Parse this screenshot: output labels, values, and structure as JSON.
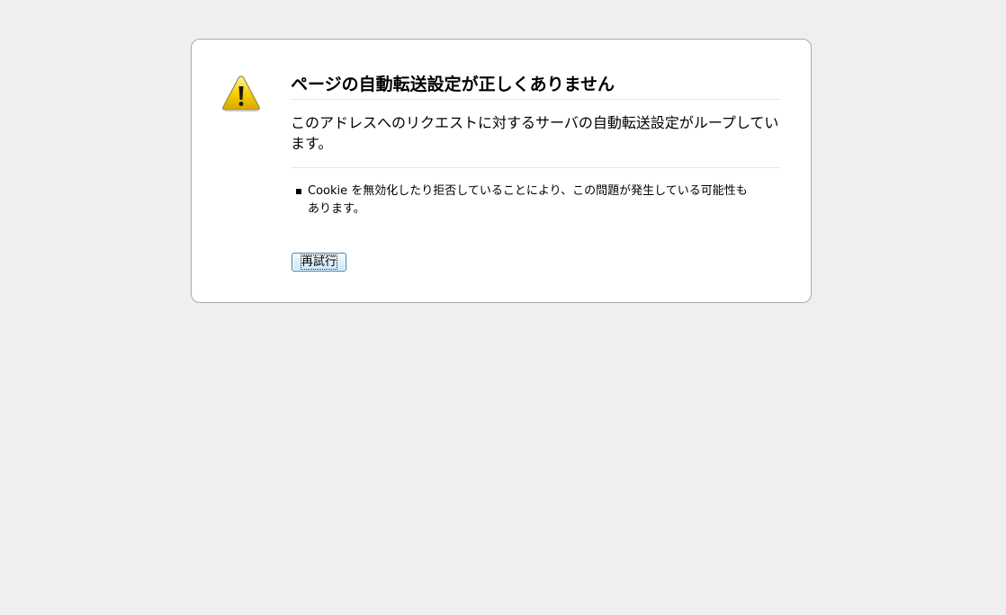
{
  "error": {
    "title": "ページの自動転送設定が正しくありません",
    "description": "このアドレスへのリクエストに対するサーバの自動転送設定がループしています。",
    "suggestions": [
      "Cookie を無効化したり拒否していることにより、この問題が発生している可能性もあります。"
    ],
    "retry_label": "再試行",
    "icon": "warning-icon"
  },
  "colors": {
    "page_background": "#efefef",
    "box_background": "#ffffff",
    "box_border": "#a9a9a9",
    "icon_fill": "#f5d100",
    "button_border": "#3c7fb1"
  }
}
